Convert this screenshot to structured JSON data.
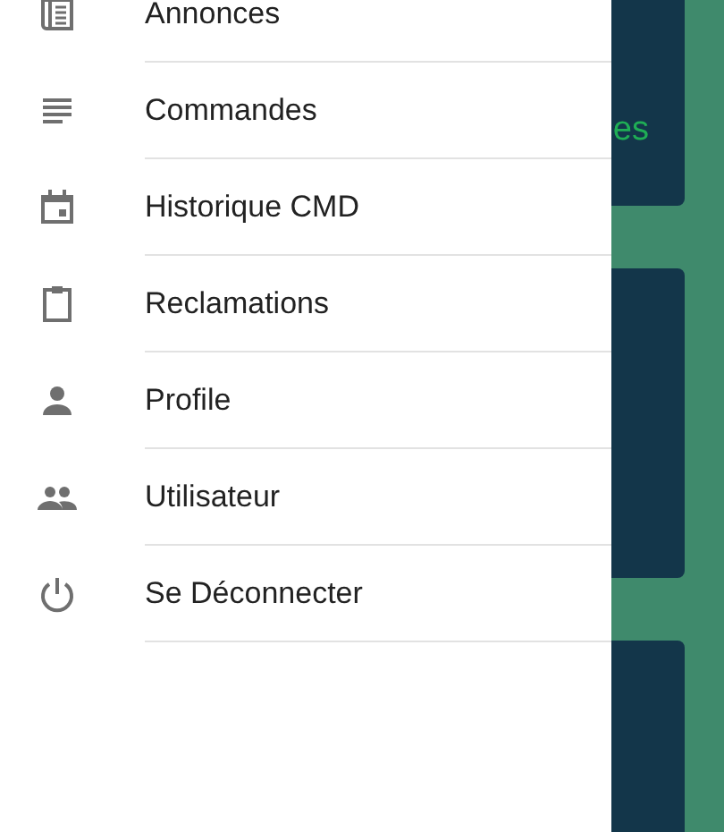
{
  "drawer": {
    "items": [
      {
        "label": "Annonces",
        "kind": "news"
      },
      {
        "label": "Commandes",
        "kind": "list"
      },
      {
        "label": "Historique CMD",
        "kind": "calendar"
      },
      {
        "label": "Reclamations",
        "kind": "clipboard"
      },
      {
        "label": "Profile",
        "kind": "person"
      },
      {
        "label": "Utilisateur",
        "kind": "group"
      },
      {
        "label": "Se Déconnecter",
        "kind": "power"
      }
    ]
  },
  "background": {
    "cards": [
      {
        "kind": "titled",
        "text": "es"
      },
      {
        "kind": "blank"
      },
      {
        "kind": "blank"
      }
    ]
  }
}
